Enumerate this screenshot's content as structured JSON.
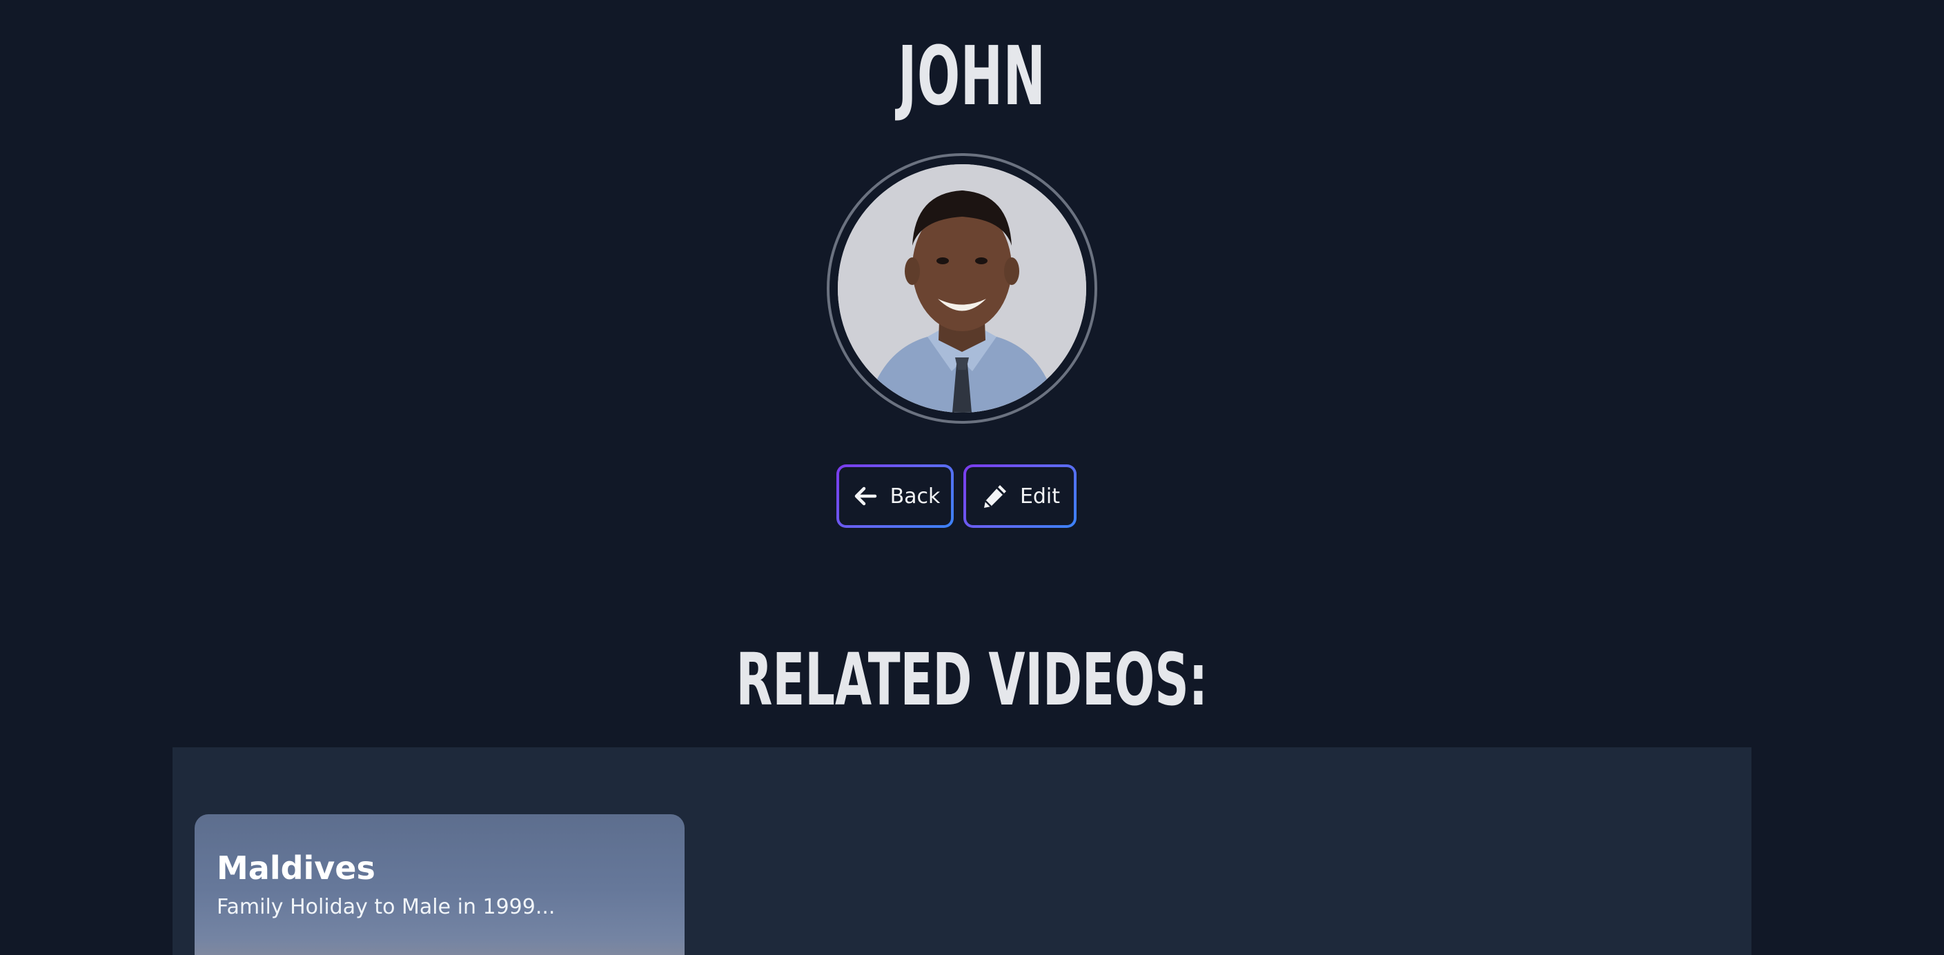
{
  "profile": {
    "name": "JOHN",
    "avatar_icon": "person-photo"
  },
  "actions": {
    "back_label": "Back",
    "back_icon": "arrow-left-icon",
    "edit_label": "Edit",
    "edit_icon": "pencil-icon"
  },
  "related": {
    "heading": "RELATED VIDEOS:",
    "videos": [
      {
        "title": "Maldives",
        "description": "Family Holiday to Male in 1999..."
      }
    ]
  },
  "colors": {
    "background": "#111827",
    "panel": "#1e293b",
    "text": "#e5e7eb",
    "button_gradient_start": "#7c3aed",
    "button_gradient_end": "#3b82f6"
  }
}
